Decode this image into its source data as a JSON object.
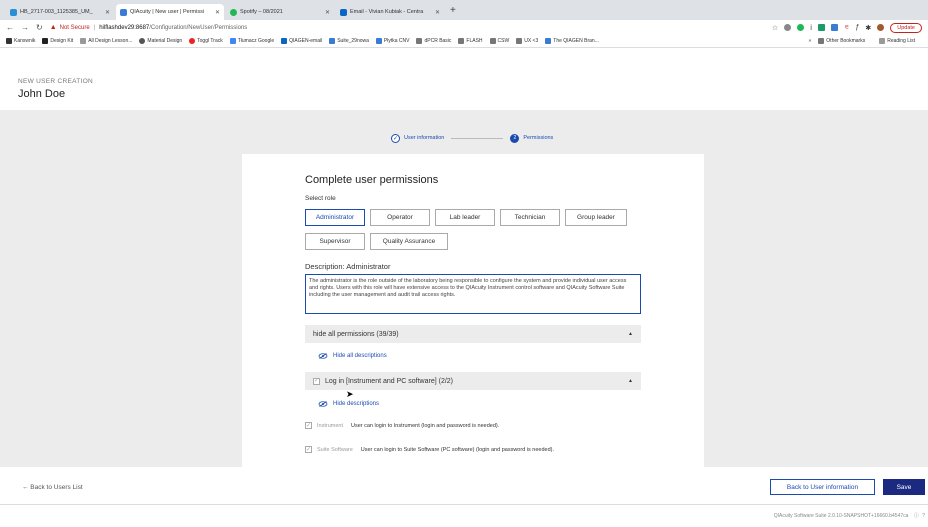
{
  "browser": {
    "tabs": [
      {
        "label": "HB_2717-003_1125385_UM_",
        "color": "#2b8fd6",
        "active": false
      },
      {
        "label": "QIAcuity | New user | Permissi",
        "color": "#3a7bd5",
        "active": true
      },
      {
        "label": "Spotify – 08/2021",
        "color": "#1db954",
        "active": false
      },
      {
        "label": "Email - Vivian Kubiak - Centra",
        "color": "#0a66c2",
        "active": false
      }
    ],
    "new_tab": "+",
    "not_secure": "Not Secure",
    "url_host": "hilflashdev29:8687",
    "url_path": "/Configuration/NewUser/Permissions",
    "update_label": "Update",
    "bookmarks": [
      {
        "label": "Kanswnik",
        "color": "#333"
      },
      {
        "label": "Design Kit",
        "color": "#222"
      },
      {
        "label": "All Design Lesson...",
        "color": "#999"
      },
      {
        "label": "Material Design",
        "color": "#555"
      },
      {
        "label": "Toggl Track",
        "color": "#e22"
      },
      {
        "label": "Tłumacz Google",
        "color": "#4285f4"
      },
      {
        "label": "QIAGEN-email",
        "color": "#0a66c2"
      },
      {
        "label": "Suite_29nowa",
        "color": "#3a7bd5"
      },
      {
        "label": "Płytka CNV",
        "color": "#3a7bd5"
      },
      {
        "label": "dPCR Basic",
        "color": "#777"
      },
      {
        "label": "FLASH",
        "color": "#777"
      },
      {
        "label": "CSW",
        "color": "#777"
      },
      {
        "label": "UX <3",
        "color": "#777"
      },
      {
        "label": "The QIAGEN Bran...",
        "color": "#3a7bd5"
      }
    ],
    "more": "»",
    "other_bookmarks": "Other Bookmarks",
    "reading_list": "Reading List"
  },
  "header": {
    "subtitle": "NEW USER CREATION",
    "title": "John Doe"
  },
  "stepper": {
    "step1": "User information",
    "step2": "Permissions",
    "step1_check": "✓",
    "step2_number": "2"
  },
  "card": {
    "title": "Complete user permissions",
    "select_role": "Select role",
    "roles": [
      "Administrator",
      "Operator",
      "Lab leader",
      "Technician",
      "Group leader",
      "Supervisor",
      "Quality Assurance"
    ],
    "selected_role": "Administrator",
    "description_label": "Description: Administrator",
    "description": "The administrator is the role outside of the laboratory being responsible to configure the system and provide individual user access and rights. Users with this role will have extensive access to the QIAcuity Instrument control software and QIAcuity Software Suite including the user management and audit trail access rights.",
    "all_permissions": "hide all permissions (39/39)",
    "hide_all_descriptions": "Hide all descriptions",
    "login_group": "Log in [Instrument and PC software] (2/2)",
    "hide_descriptions": "Hide descriptions",
    "permissions": [
      {
        "name": "Instrument",
        "description": "User can login to Instrument (login and password is needed)."
      },
      {
        "name": "Suite Software",
        "description": "User can login to Suite Software (PC software) (login and password is needed)."
      }
    ]
  },
  "footer": {
    "back_to_users": "← Back to Users List",
    "back_to_info": "Back to User information",
    "save": "Save",
    "version": "QIAcuity Software Suite 2.0.10-SNAPSHOT+16660.b4547ca"
  },
  "colors": {
    "accent": "#1b4bb0",
    "primary_button": "#1b2a80",
    "page_background": "#ececec"
  }
}
